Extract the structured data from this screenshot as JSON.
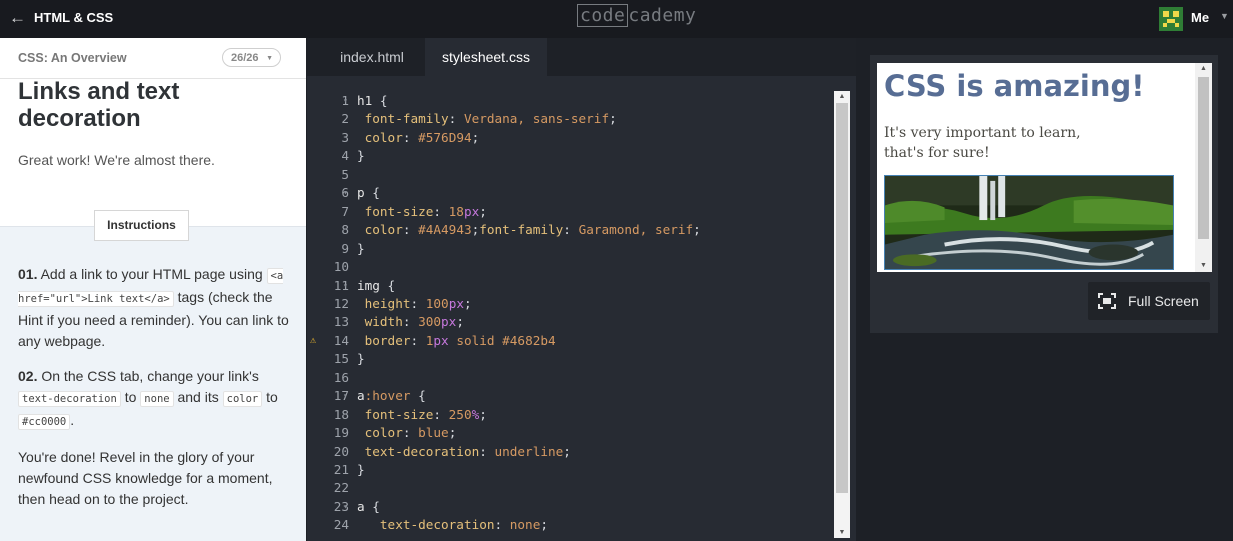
{
  "topbar": {
    "back_icon": "arrow-left-icon",
    "course_title": "HTML & CSS",
    "logo_left": "code",
    "logo_right": "cademy",
    "user_name": "Me"
  },
  "lesson": {
    "section": "CSS: An Overview",
    "progress": "26/26",
    "title": "Links and text decoration",
    "intro": "Great work! We're almost there.",
    "instructions_label": "Instructions",
    "step1": {
      "num": "01.",
      "t1": "Add a link to your HTML page using",
      "code": "<a href=\"url\">Link text</a>",
      "t2": "tags (check the Hint if you need a reminder). You can link to any webpage."
    },
    "step2": {
      "num": "02.",
      "t1": "On the CSS tab, change your link's",
      "code1": "text-decoration",
      "t2": "to",
      "code2": "none",
      "t3": "and its",
      "code3": "color",
      "t4": "to",
      "code4": "#cc0000",
      "t5": "."
    },
    "done": "You're done! Revel in the glory of your newfound CSS knowledge for a moment, then head on to the project."
  },
  "editor": {
    "tabs": [
      "index.html",
      "stylesheet.css"
    ],
    "active_tab": "stylesheet.css",
    "warning_line": 14,
    "lines": [
      "h1 {",
      " font-family: Verdana, sans-serif;",
      " color: #576D94;",
      "}",
      "",
      "p {",
      " font-size: 18px;",
      " color: #4A4943;font-family: Garamond, serif;",
      "}",
      "",
      "img {",
      " height: 100px;",
      " width: 300px;",
      " border: 1px solid #4682b4",
      "}",
      "",
      "a:hover {",
      " font-size: 250%;",
      " color: blue;",
      " text-decoration: underline;",
      "}",
      "",
      "a {",
      "   text-decoration: none;"
    ]
  },
  "preview": {
    "heading": "CSS is amazing!",
    "paragraph": "It's very important to learn, that's for sure!",
    "fullscreen_label": "Full Screen",
    "colors": {
      "h1": "#576D94",
      "p": "#4A4943",
      "border": "#4682b4"
    }
  }
}
